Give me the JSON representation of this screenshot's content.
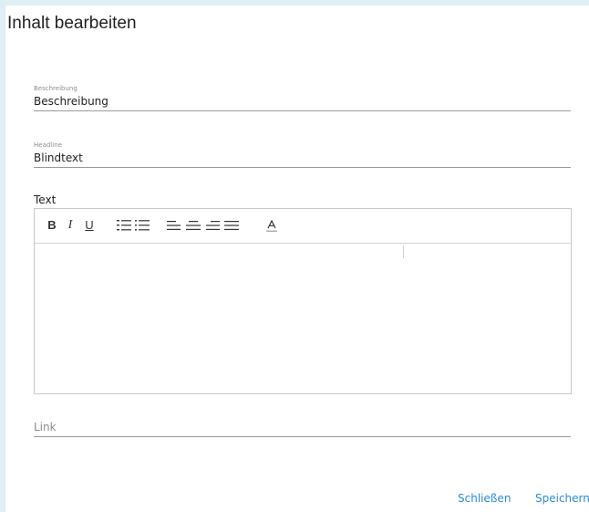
{
  "dialog": {
    "title": "Inhalt bearbeiten"
  },
  "fields": {
    "beschreibung": {
      "label": "Beschreibung",
      "value": "Beschreibung"
    },
    "headline": {
      "label": "Headline",
      "value": "Blindtext"
    },
    "text": {
      "label": "Text",
      "value": ""
    },
    "link": {
      "placeholder": "Link",
      "value": ""
    }
  },
  "toolbar": {
    "bold": "B",
    "italic": "I",
    "underline": "U",
    "icons": [
      "ordered-list-icon",
      "bullet-list-icon",
      "align-left-icon",
      "align-center-icon",
      "align-right-icon",
      "align-justify-icon",
      "text-color-icon"
    ],
    "color_glyph": "A"
  },
  "footer": {
    "close_label": "Schließen",
    "save_label": "Speichern"
  },
  "colors": {
    "accent": "#2a8bd8",
    "background": "#dfeef4"
  }
}
